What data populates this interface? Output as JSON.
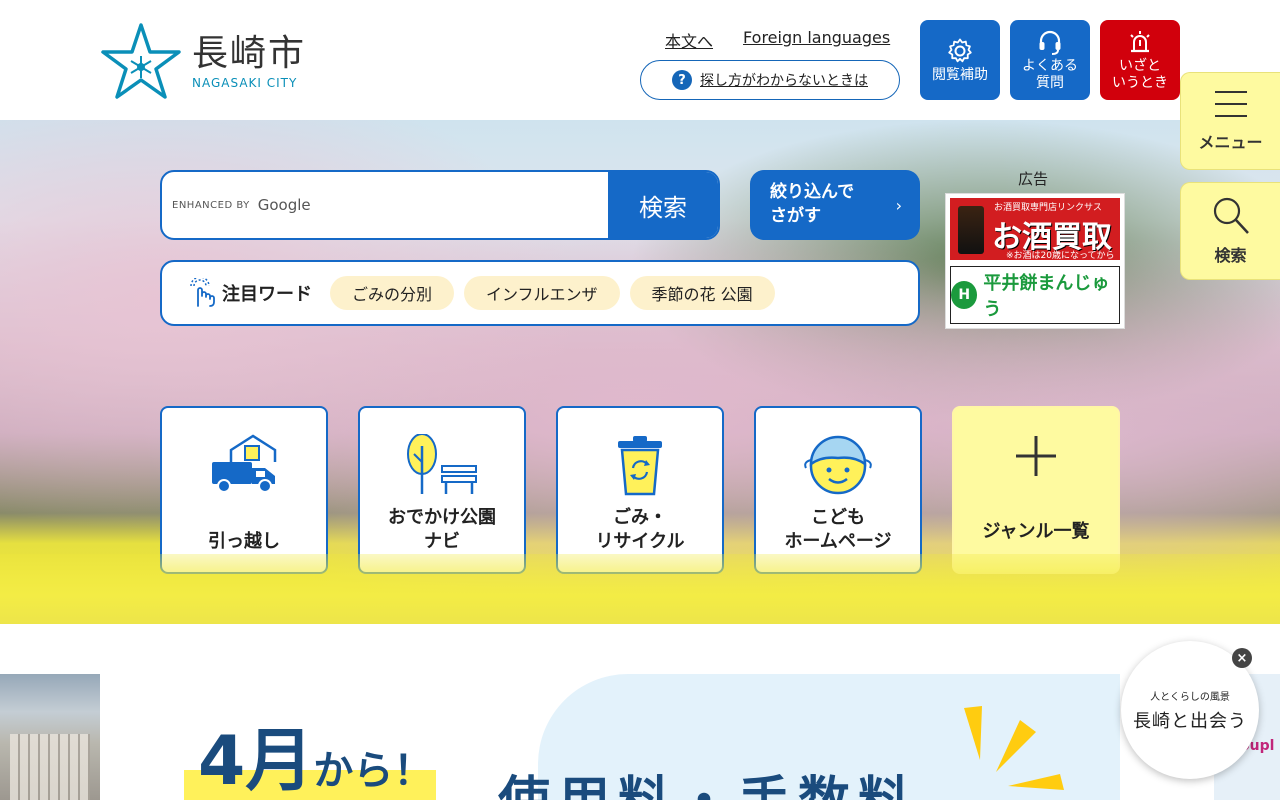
{
  "header": {
    "logo_ja": "長崎市",
    "logo_en": "NAGASAKI CITY",
    "links": {
      "main_text": "本文へ",
      "foreign": "Foreign languages"
    },
    "help_button": "探し方がわからないときは",
    "help_mark": "?",
    "buttons": {
      "accessibility": "閲覧補助",
      "faq_line1": "よくある",
      "faq_line2": "質問",
      "emergency_line1": "いざと",
      "emergency_line2": "いうとき"
    },
    "colors": {
      "accent": "#1569c7",
      "emergency": "#d1000c",
      "side": "#fefaa0"
    }
  },
  "side": {
    "menu": "メニュー",
    "search": "検索"
  },
  "search": {
    "enhanced_by": "ENHANCED BY",
    "google": "Google",
    "submit": "検索",
    "narrow_line1": "絞り込んで",
    "narrow_line2": "さがす",
    "narrow_chevron": "›"
  },
  "ad": {
    "label": "広告",
    "ad1_small": "お酒買取専門店リンクサス",
    "ad1_big": "お酒買取",
    "ad1_note": "※お酒は20歳になってから",
    "ad2_mark": "H",
    "ad2_text": "平井餅まんじゅう"
  },
  "keywords": {
    "title": "注目ワード",
    "chips": [
      "ごみの分別",
      "インフルエンザ",
      "季節の花 公園"
    ]
  },
  "tiles": {
    "moving": "引っ越し",
    "park_line1": "おでかけ公園",
    "park_line2": "ナビ",
    "gomi_line1": "ごみ・",
    "gomi_line2": "リサイクル",
    "kodomo_line1": "こども",
    "kodomo_line2": "ホームページ",
    "genre": "ジャンル一覧"
  },
  "banner": {
    "month": "4月",
    "kara": "から！",
    "fee": "使用料・手数料"
  },
  "right_strip": "oupl",
  "deai": {
    "small": "人とくらしの風景",
    "big": "長崎と出会う",
    "close": "×"
  }
}
